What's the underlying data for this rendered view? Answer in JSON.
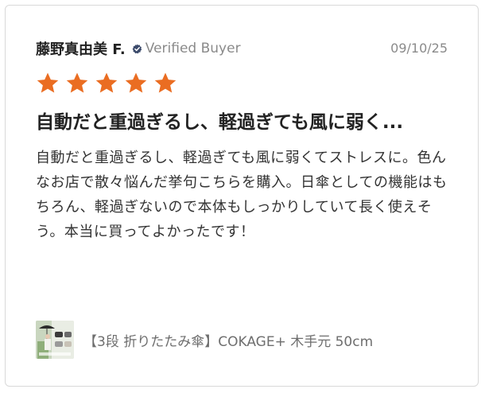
{
  "review": {
    "reviewer_name": "藤野真由美 F.",
    "verified_label": "Verified Buyer",
    "date": "09/10/25",
    "rating": 5,
    "max_rating": 5,
    "title": "自動だと重過ぎるし、軽過ぎても風に弱く...",
    "body": "自動だと重過ぎるし、軽過ぎても風に弱くてストレスに。色んなお店で散々悩んだ挙句こちらを購入。日傘としての機能はもちろん、軽過ぎないので本体もしっかりしていて長く使えそう。本当に買ってよかったです！"
  },
  "product": {
    "name": "【3段 折りたたみ傘】COKAGE+ 木手元 50cm",
    "thumbnail_icon": "umbrella-product-photo"
  },
  "colors": {
    "star": "#ea6d22",
    "verified_icon": "#3b4a6b",
    "text_primary": "#222222",
    "text_muted": "#8a8a8a",
    "border": "#d9d9d9"
  }
}
